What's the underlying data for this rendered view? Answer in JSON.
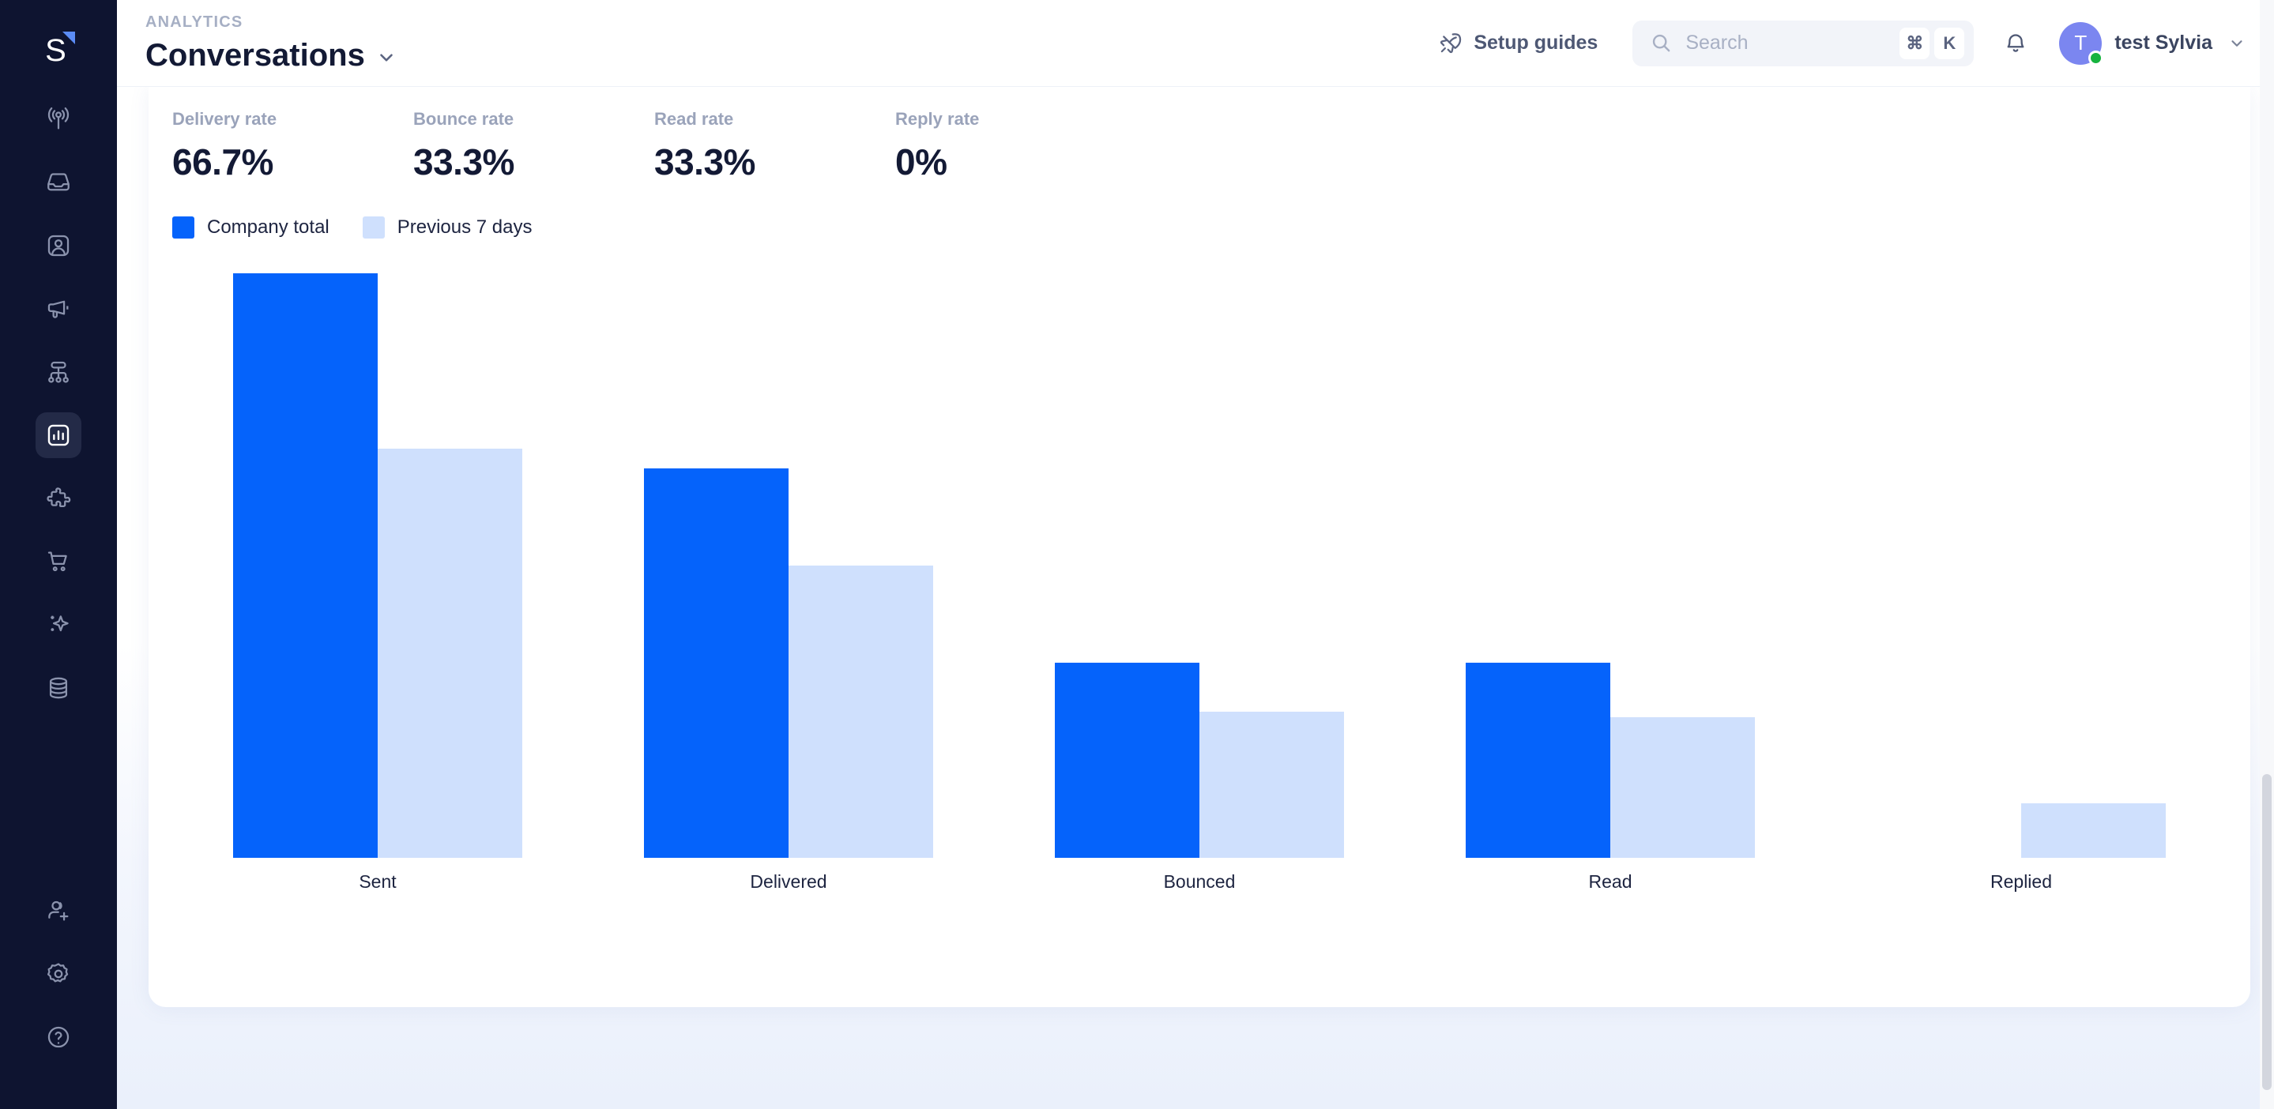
{
  "sidebar": {
    "logo": {
      "letter": "S",
      "accent_color": "#5b8cf5",
      "name": "logo"
    },
    "items": [
      {
        "name": "sidebar-item-broadcast",
        "icon": "broadcast-antenna-icon",
        "active": false
      },
      {
        "name": "sidebar-item-inbox",
        "icon": "inbox-icon",
        "active": false
      },
      {
        "name": "sidebar-item-contacts",
        "icon": "contact-card-icon",
        "active": false
      },
      {
        "name": "sidebar-item-campaigns",
        "icon": "megaphone-icon",
        "active": false
      },
      {
        "name": "sidebar-item-workflows",
        "icon": "workflow-hierarchy-icon",
        "active": false
      },
      {
        "name": "sidebar-item-analytics",
        "icon": "bar-chart-icon",
        "active": true
      },
      {
        "name": "sidebar-item-integrations",
        "icon": "puzzle-piece-icon",
        "active": false
      },
      {
        "name": "sidebar-item-commerce",
        "icon": "shopping-cart-icon",
        "active": false
      },
      {
        "name": "sidebar-item-ai",
        "icon": "sparkle-icon",
        "active": false
      },
      {
        "name": "sidebar-item-data",
        "icon": "database-icon",
        "active": false
      }
    ],
    "bottom_items": [
      {
        "name": "sidebar-item-invite",
        "icon": "add-user-icon"
      },
      {
        "name": "sidebar-item-settings",
        "icon": "gear-icon"
      },
      {
        "name": "sidebar-item-help",
        "icon": "help-circle-icon"
      }
    ]
  },
  "header": {
    "eyebrow": "ANALYTICS",
    "title": "Conversations",
    "title_dropdown_icon": "chevron-down-icon",
    "setup_guides": {
      "label": "Setup guides",
      "icon": "rocket-icon"
    },
    "search": {
      "placeholder": "Search",
      "icon": "search-icon",
      "shortcut_modifier": "⌘",
      "shortcut_key": "K"
    },
    "notifications_icon": "bell-icon",
    "user": {
      "name": "test Sylvia",
      "avatar_initial": "T",
      "avatar_color": "#7b86f0",
      "presence_color": "#16b33f",
      "dropdown_icon": "chevron-down-icon"
    }
  },
  "metrics": [
    {
      "label": "Delivery rate",
      "value": "66.7%"
    },
    {
      "label": "Bounce rate",
      "value": "33.3%"
    },
    {
      "label": "Read rate",
      "value": "33.3%"
    },
    {
      "label": "Reply rate",
      "value": "0%"
    }
  ],
  "chart_data": {
    "type": "bar",
    "title": "",
    "xlabel": "",
    "ylabel": "",
    "grid": false,
    "legend_position": "top-left",
    "categories": [
      "Sent",
      "Delivered",
      "Bounced",
      "Read",
      "Replied"
    ],
    "colors": {
      "primary": "#0563fb",
      "previous": "#cfe0fd"
    },
    "series": [
      {
        "name": "Company total",
        "color": "#0563fb",
        "values": [
          3,
          2,
          1,
          1,
          0
        ]
      },
      {
        "name": "Previous 7 days",
        "color": "#cfe0fd",
        "values": [
          2.1,
          1.5,
          0.75,
          0.72,
          0.28
        ]
      }
    ],
    "ylim": [
      0,
      3
    ]
  }
}
